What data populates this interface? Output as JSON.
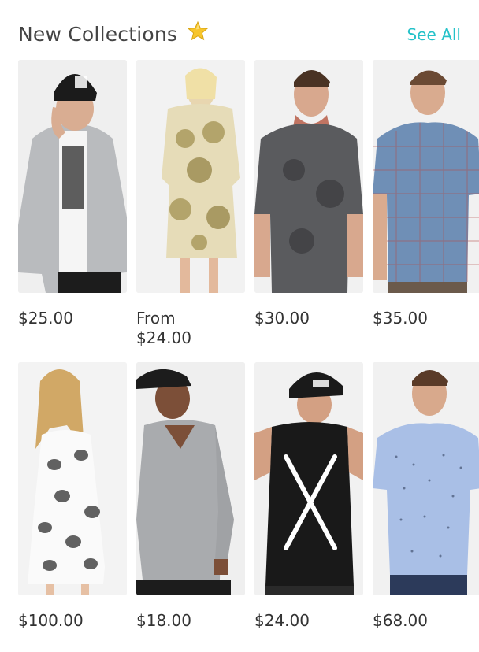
{
  "header": {
    "title": "New Collections",
    "see_all": "See All"
  },
  "products": [
    {
      "price": "$25.00",
      "image": "man-grey-bomber-beanie"
    },
    {
      "price_line1": "From",
      "price_line2": "$24.00",
      "image": "woman-gold-paisley-dress"
    },
    {
      "price": "$30.00",
      "image": "tattooed-man-grey-tee"
    },
    {
      "price": "$35.00",
      "image": "man-blue-check-shirt"
    },
    {
      "price": "$100.00",
      "image": "woman-elephant-print-dress"
    },
    {
      "price": "$18.00",
      "image": "man-grey-v-neck-cap"
    },
    {
      "price": "$24.00",
      "image": "man-black-tank-cap"
    },
    {
      "price": "$68.00",
      "image": "man-light-blue-print-shirt"
    }
  ]
}
